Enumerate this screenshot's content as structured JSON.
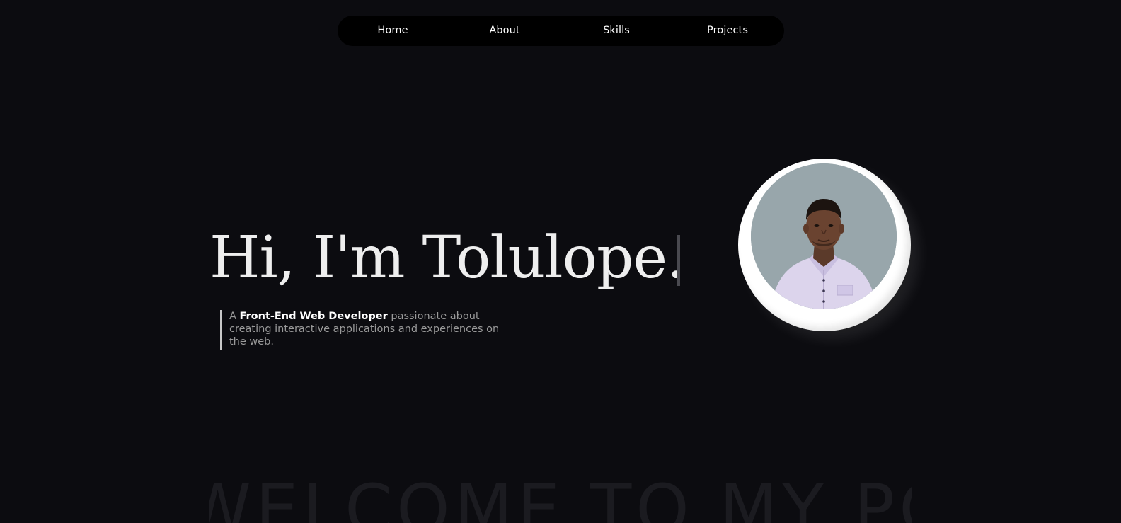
{
  "nav": {
    "items": [
      {
        "label": "Home"
      },
      {
        "label": "About"
      },
      {
        "label": "Skills"
      },
      {
        "label": "Projects"
      }
    ]
  },
  "hero": {
    "title": "Hi, I'm Tolulope.",
    "tagline_prefix": "A ",
    "tagline_role": "Front-End Web Developer",
    "tagline_rest": " passionate about creating interactive applications and experiences on the web."
  },
  "marquee": {
    "text": "WELCOME TO MY PORTFOLIO"
  },
  "colors": {
    "background": "#0c0c10",
    "nav_background": "#000000",
    "accent_text": "#ffffff",
    "muted_text": "#9a9a9a",
    "avatar_background": "#98a6ab"
  }
}
